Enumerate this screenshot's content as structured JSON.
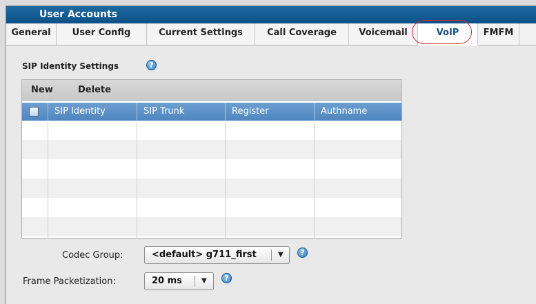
{
  "window": {
    "title": "User Accounts"
  },
  "tabs": [
    {
      "label": "General"
    },
    {
      "label": "User Config"
    },
    {
      "label": "Current Settings"
    },
    {
      "label": "Call Coverage"
    },
    {
      "label": "Voicemail"
    },
    {
      "label": "VoIP",
      "active": true
    },
    {
      "label": "FMFM"
    }
  ],
  "section": {
    "title": "SIP Identity Settings",
    "help": "?"
  },
  "toolbar": {
    "new_label": "New",
    "delete_label": "Delete"
  },
  "table": {
    "columns": [
      "SIP Identity",
      "SIP Trunk",
      "Register",
      "Authname"
    ],
    "rows": []
  },
  "codec_group": {
    "label": "Codec Group:",
    "value": "<default> g711_first"
  },
  "frame_packetization": {
    "label": "Frame Packetization:",
    "value": "20 ms"
  },
  "colors": {
    "header_blue": "#0b5187",
    "grid_header": "#5b8fc6",
    "highlight_ring": "#d42a2a"
  }
}
